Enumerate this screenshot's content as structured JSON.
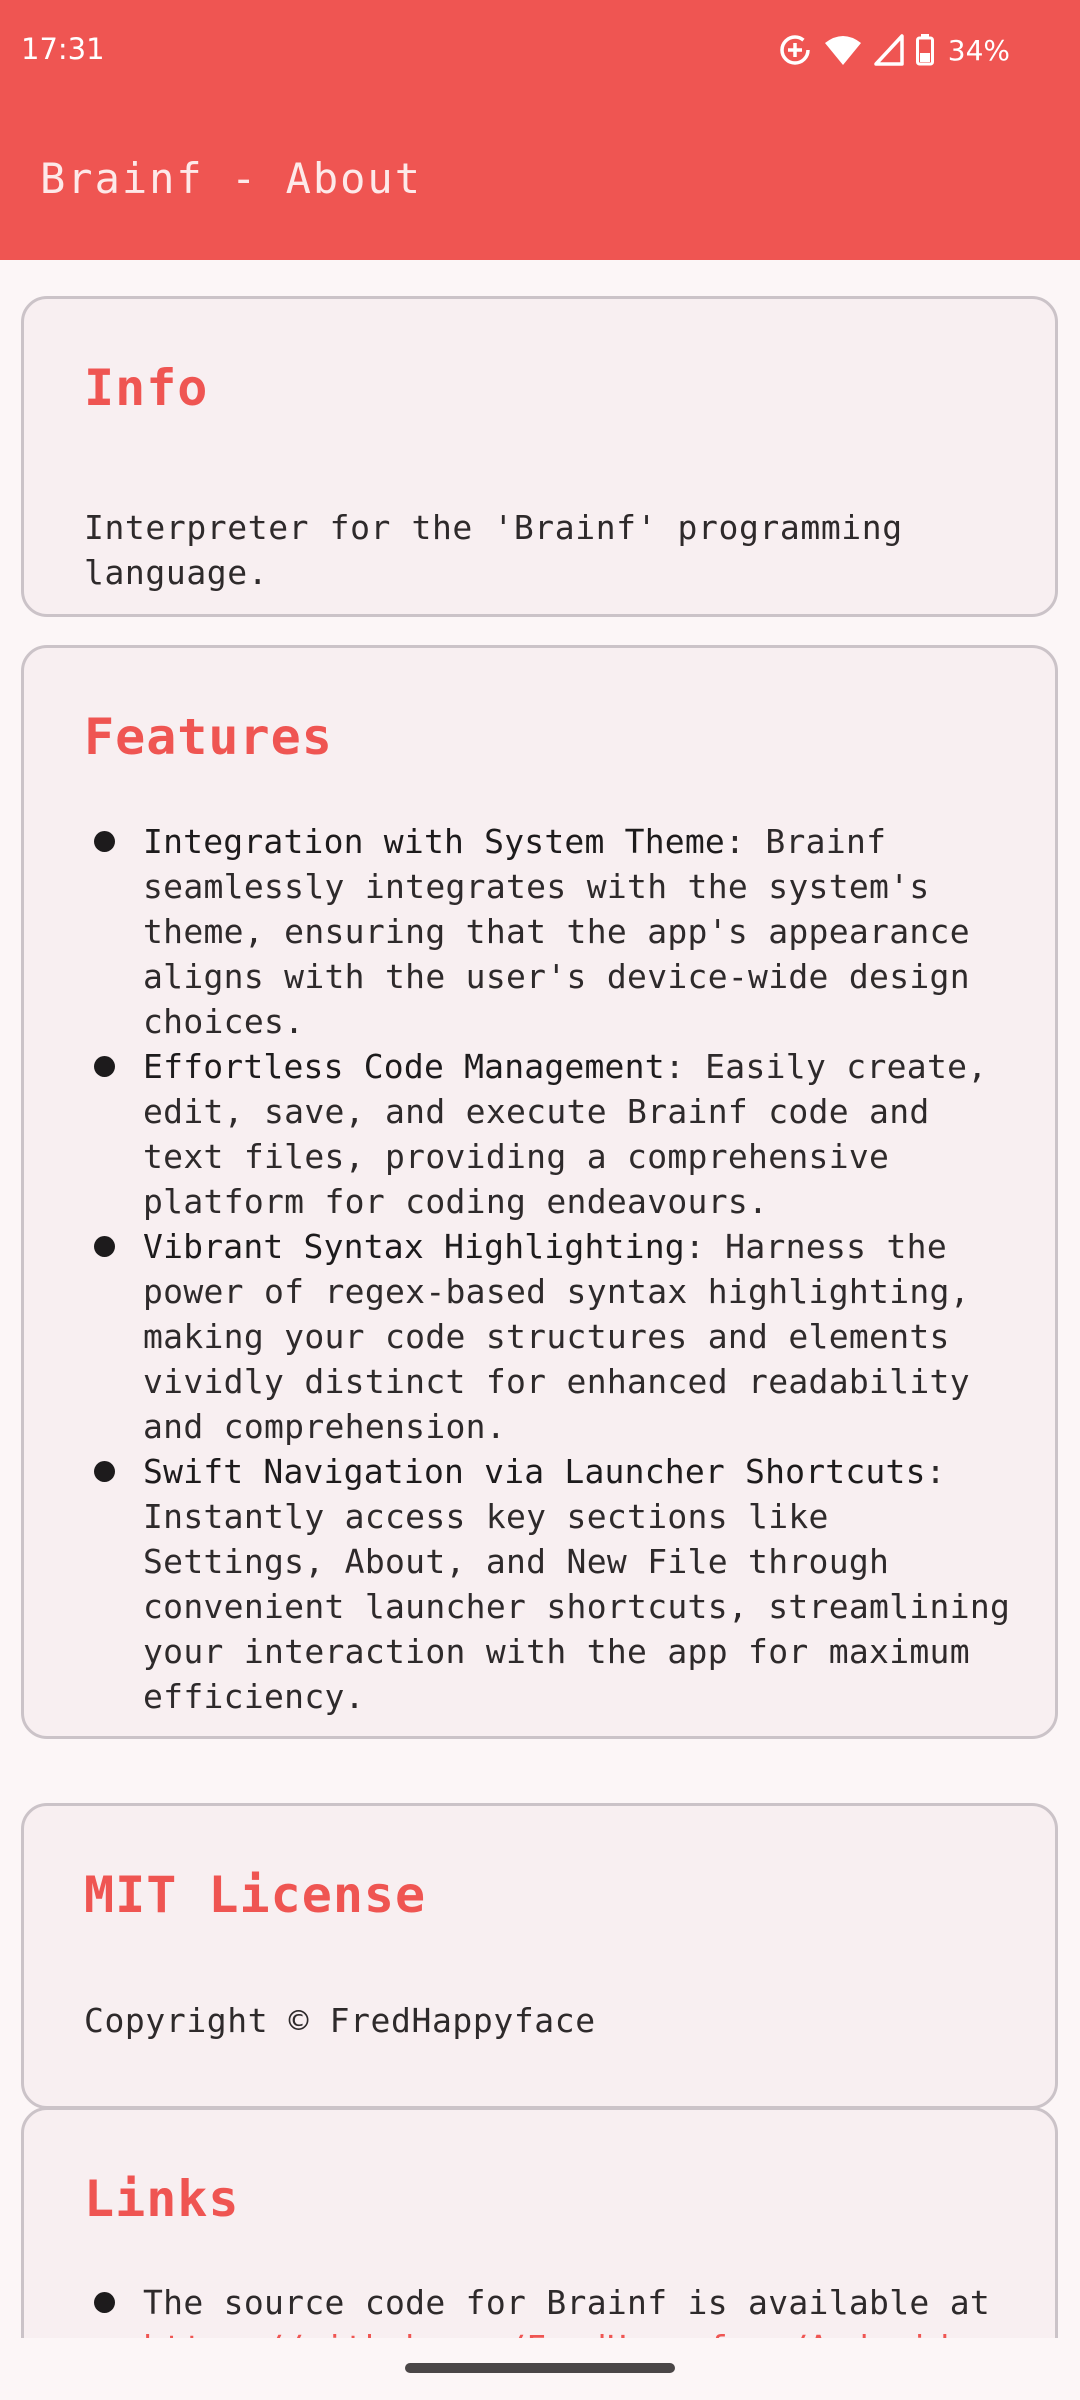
{
  "status_bar": {
    "time": "17:31",
    "battery": "34%",
    "icons": [
      "data-saver-icon",
      "wifi-icon",
      "cellular-signal-icon",
      "battery-icon"
    ]
  },
  "app_bar": {
    "title": "Brainf - About"
  },
  "cards": {
    "info": {
      "title": "Info",
      "body": "Interpreter for the 'Brainf' programming language."
    },
    "features": {
      "title": "Features",
      "items": [
        {
          "title": "Integration with System Theme",
          "text": "Brainf seamlessly integrates with the system's theme, ensuring that the app's appearance aligns with the user's device-wide design choices."
        },
        {
          "title": "Effortless Code Management",
          "text": "Easily create, edit, save, and execute Brainf code and text files, providing a comprehensive platform for coding endeavours."
        },
        {
          "title": "Vibrant Syntax Highlighting",
          "text": "Harness the power of regex-based syntax highlighting, making your code structures and elements vividly distinct for enhanced readability and comprehension."
        },
        {
          "title": "Swift Navigation via Launcher Shortcuts",
          "text": "Instantly access key sections like Settings, About, and New File through convenient launcher shortcuts, streamlining your interaction with the app for maximum efficiency."
        }
      ]
    },
    "license": {
      "title": "MIT License",
      "body": "Copyright © FredHappyface"
    },
    "links": {
      "title": "Links",
      "items": [
        {
          "text": "The source code for Brainf is available at",
          "link": "https://github.com/FredHappyface/Android"
        }
      ]
    }
  },
  "colors": {
    "accent": "#ef5552",
    "card_background": "#f8eff1",
    "card_border": "#cbc3c8",
    "page_background": "#fcf6f7"
  }
}
